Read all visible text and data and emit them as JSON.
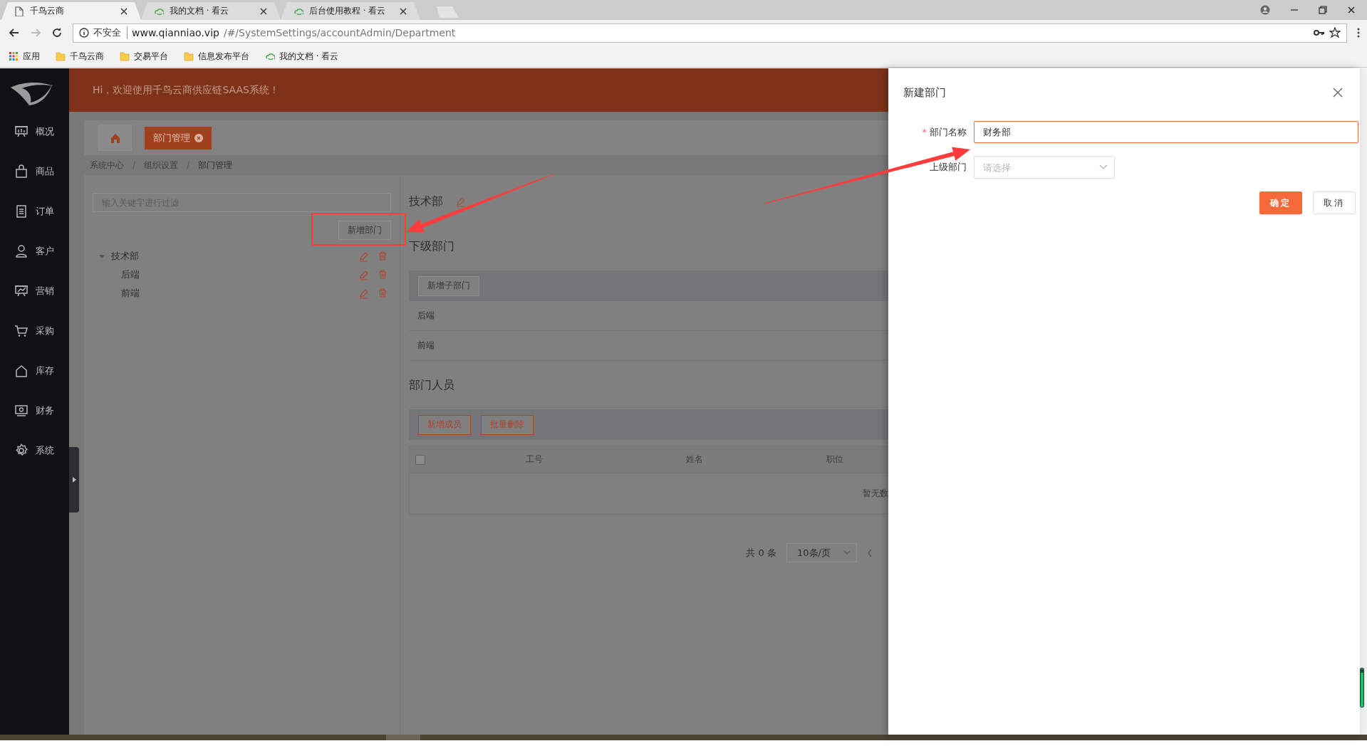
{
  "browser": {
    "tabs": [
      {
        "kind": "page",
        "title": "千鸟云商",
        "selected": true
      },
      {
        "kind": "site",
        "title": "我的文档 · 看云",
        "selected": false
      },
      {
        "kind": "site",
        "title": "后台使用教程 · 看云",
        "selected": false
      }
    ],
    "address": {
      "security": "不安全",
      "host": "www.qianniao.vip",
      "path": "/#/SystemSettings/accountAdmin/Department"
    },
    "bookmarks": [
      {
        "kind": "apps",
        "label": "应用"
      },
      {
        "kind": "folder",
        "label": "千鸟云商"
      },
      {
        "kind": "folder",
        "label": "交易平台"
      },
      {
        "kind": "folder",
        "label": "信息发布平台"
      },
      {
        "kind": "site",
        "label": "我的文档 · 看云"
      }
    ]
  },
  "sidebar": {
    "items": [
      "概况",
      "商品",
      "订单",
      "客户",
      "营销",
      "采购",
      "库存",
      "财务",
      "系统"
    ]
  },
  "header": {
    "greeting": "Hi，欢迎使用千鸟云商供应链SAAS系统！"
  },
  "page_tabs": [
    {
      "label": "部门管理",
      "selected": true
    }
  ],
  "breadcrumb": {
    "items": [
      "系统中心",
      "组织设置",
      "部门管理"
    ],
    "separator": "/"
  },
  "tree": {
    "filter_placeholder": "输入关键字进行过滤",
    "add_button": "新增部门",
    "nodes": [
      {
        "label": "技术部",
        "expanded": true,
        "children": [
          {
            "label": "后端"
          },
          {
            "label": "前端"
          }
        ]
      }
    ]
  },
  "detail": {
    "title": "技术部",
    "sub_title": "下级部门",
    "add_child_button": "新增子部门",
    "sub_departments": [
      "后端",
      "前端"
    ],
    "members_title": "部门人员",
    "member_buttons": [
      "新增成员",
      "批量删除"
    ],
    "table": {
      "select_all": {
        "checked": false
      },
      "columns": [
        "工号",
        "姓名",
        "职位"
      ],
      "empty_text": "暂无数"
    },
    "pagination": {
      "total": "共 0 条",
      "page_size": "10条/页"
    }
  },
  "drawer": {
    "title": "新建部门",
    "required_mark": "*",
    "fields": [
      {
        "kind": "input",
        "label": "部门名称",
        "required": true,
        "value": "财务部"
      },
      {
        "kind": "select",
        "label": "上级部门",
        "required": false,
        "placeholder": "请选择"
      }
    ],
    "buttons": [
      {
        "kind": "primary",
        "label": "确定"
      },
      {
        "kind": "default",
        "label": "取消"
      }
    ]
  }
}
